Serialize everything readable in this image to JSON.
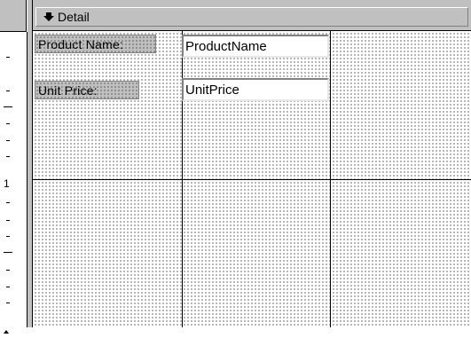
{
  "section": {
    "title": "Detail",
    "arrow_icon": "down-arrow-icon"
  },
  "ruler": {
    "numbers": [
      "1"
    ]
  },
  "controls": {
    "product_name_label": "Product Name:",
    "product_name_field": "ProductName",
    "unit_price_label": "Unit Price:",
    "unit_price_field": "UnitPrice"
  },
  "colors": {
    "frame": "#c0c0c0",
    "grid_background": "#ffffff",
    "grid_dots": "#000000"
  }
}
